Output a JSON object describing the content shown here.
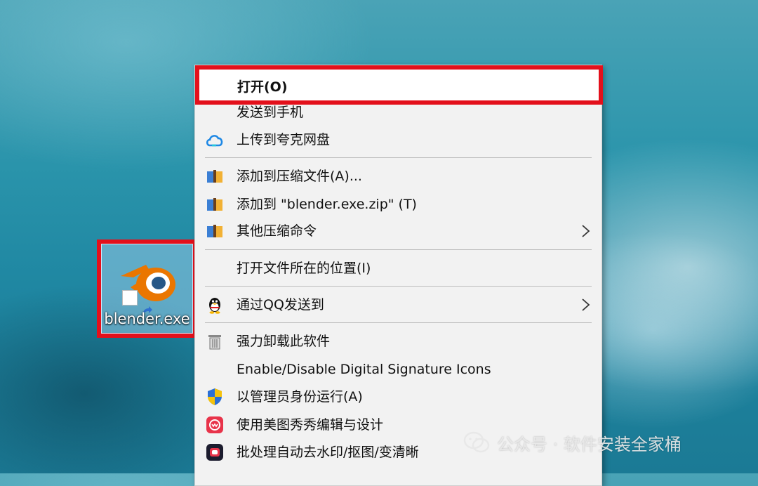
{
  "desktop": {
    "icon_label": "blender.exe"
  },
  "context_menu": {
    "items": [
      {
        "label": "打开(O)"
      },
      {
        "label": "发送到手机"
      },
      {
        "label": "上传到夸克网盘"
      },
      {
        "label": "添加到压缩文件(A)..."
      },
      {
        "label": "添加到 \"blender.exe.zip\" (T)"
      },
      {
        "label": "其他压缩命令"
      },
      {
        "label": "打开文件所在的位置(I)"
      },
      {
        "label": "通过QQ发送到"
      },
      {
        "label": "强力卸载此软件"
      },
      {
        "label": "Enable/Disable Digital Signature Icons"
      },
      {
        "label": "以管理员身份运行(A)"
      },
      {
        "label": "使用美图秀秀编辑与设计"
      },
      {
        "label": "批处理自动去水印/抠图/变清晰"
      }
    ]
  },
  "watermark": {
    "text": "公众号 · 软件安装全家桶"
  },
  "colors": {
    "highlight_border": "#e3101b",
    "menu_background": "#f2f2f2"
  }
}
